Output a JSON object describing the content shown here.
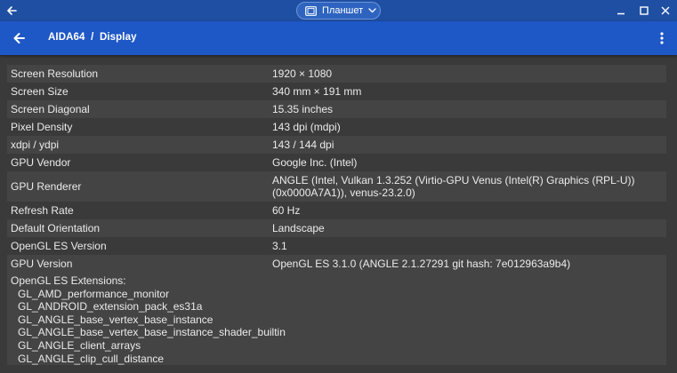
{
  "window": {
    "center_label": "Планшет"
  },
  "app_bar": {
    "title": "AIDA64  /  Display"
  },
  "rows": [
    {
      "key": "Screen Resolution",
      "value": "1920 × 1080"
    },
    {
      "key": "Screen Size",
      "value": "340 mm × 191 mm"
    },
    {
      "key": "Screen Diagonal",
      "value": "15.35 inches"
    },
    {
      "key": "Pixel Density",
      "value": "143 dpi (mdpi)"
    },
    {
      "key": "xdpi / ydpi",
      "value": "143 / 144 dpi"
    },
    {
      "key": "GPU Vendor",
      "value": "Google Inc. (Intel)"
    },
    {
      "key": "GPU Renderer",
      "value": "ANGLE (Intel, Vulkan 1.3.252 (Virtio-GPU Venus (Intel(R) Graphics (RPL-U)) (0x0000A7A1)), venus-23.2.0)"
    },
    {
      "key": "Refresh Rate",
      "value": "60 Hz"
    },
    {
      "key": "Default Orientation",
      "value": "Landscape"
    },
    {
      "key": "OpenGL ES Version",
      "value": "3.1"
    },
    {
      "key": "GPU Version",
      "value": "OpenGL ES 3.1.0 (ANGLE 2.1.27291 git hash: 7e012963a9b4)"
    }
  ],
  "extensions": {
    "heading": "OpenGL ES Extensions:",
    "items": [
      "GL_AMD_performance_monitor",
      "GL_ANDROID_extension_pack_es31a",
      "GL_ANGLE_base_vertex_base_instance",
      "GL_ANGLE_base_vertex_base_instance_shader_builtin",
      "GL_ANGLE_client_arrays",
      "GL_ANGLE_clip_cull_distance"
    ]
  },
  "colors": {
    "window_bar": "#1f4fa3",
    "app_bar": "#1e57c6",
    "background": "#3a3a3a",
    "row_alt": "#444444",
    "text": "#ebebeb"
  },
  "icons": {
    "window_back": "arrow-left-icon",
    "tablet_mode": "tablet-icon",
    "dropdown": "chevron-down-icon",
    "minimize": "minimize-icon",
    "maximize": "maximize-icon",
    "close": "close-icon",
    "app_back": "arrow-left-icon",
    "overflow_menu": "more-vert-icon"
  }
}
